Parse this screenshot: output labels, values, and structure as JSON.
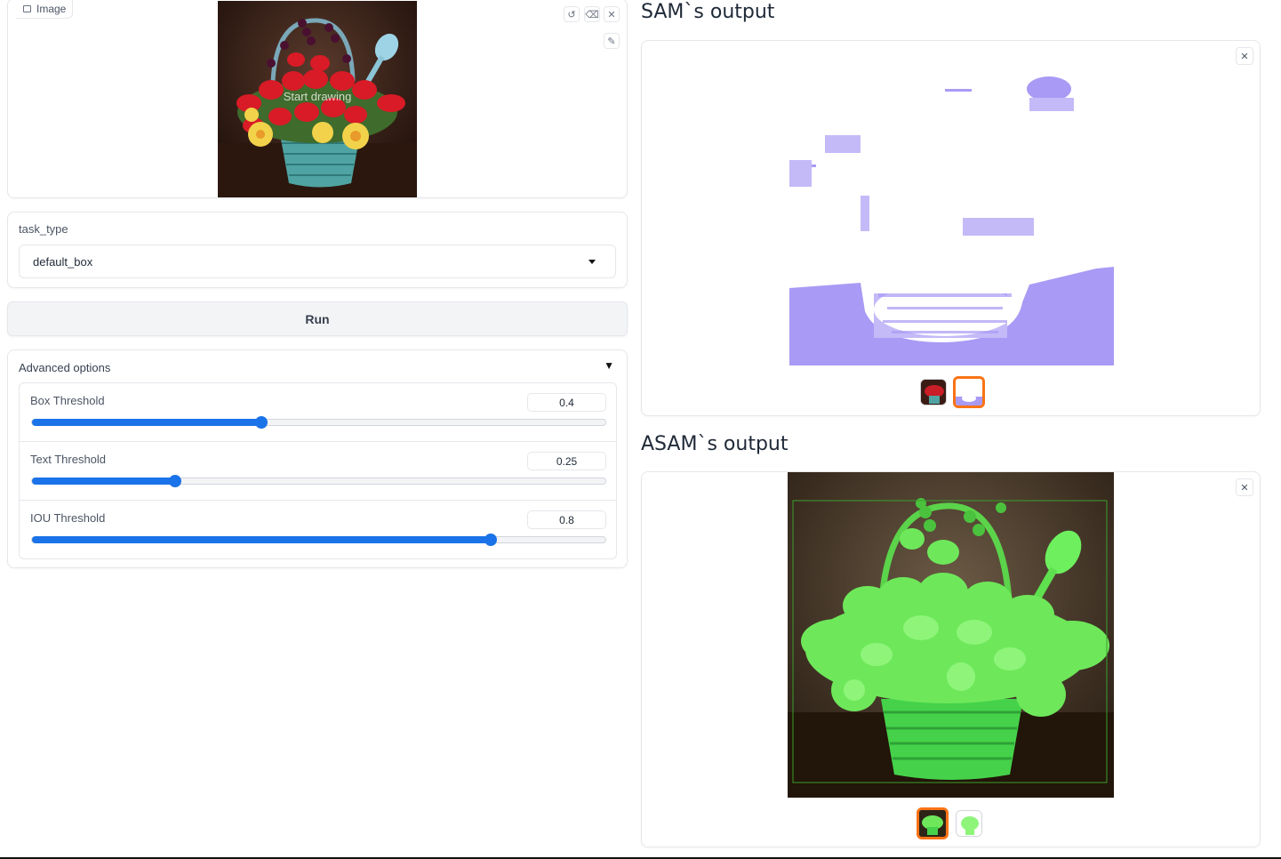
{
  "input": {
    "label": "Image",
    "label_icon": "image-icon",
    "overlay_text": "Start drawing",
    "tools": [
      "undo-icon",
      "eraser-icon",
      "close-icon",
      "brush-icon"
    ]
  },
  "task_type": {
    "label": "task_type",
    "value": "default_box"
  },
  "run_button": {
    "label": "Run"
  },
  "advanced": {
    "title": "Advanced options",
    "toggle_glyph": "▼",
    "sliders": [
      {
        "label": "Box Threshold",
        "value": "0.4",
        "fraction": 0.4
      },
      {
        "label": "Text Threshold",
        "value": "0.25",
        "fraction": 0.25
      },
      {
        "label": "IOU Threshold",
        "value": "0.8",
        "fraction": 0.8
      }
    ]
  },
  "sam_output": {
    "title": "SAM`s output",
    "close_glyph": "✕",
    "selected_thumbnail": 1
  },
  "asam_output": {
    "title": "ASAM`s output",
    "close_glyph": "✕",
    "selected_thumbnail": 0
  },
  "colors": {
    "accent": "#1a73e8",
    "selection": "#f97316",
    "sam_mask": "#a99af5",
    "asam_mask": "#6bf05a"
  }
}
